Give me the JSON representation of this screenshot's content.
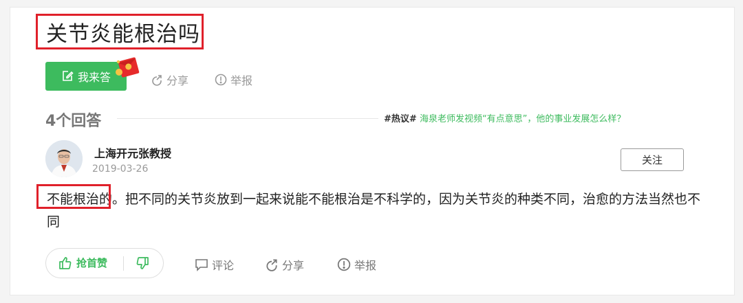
{
  "question": {
    "title": "关节炎能根治吗"
  },
  "toolbar": {
    "answer_label": "我来答",
    "share_label": "分享",
    "report_label": "举报"
  },
  "answers": {
    "count_label": "4个回答",
    "hot_topic_tag": "#热议#",
    "hot_topic_link": "海泉老师发视频“有点意思”，他的事业发展怎么样？"
  },
  "answer": {
    "author": "上海开元张教授",
    "date": "2019-03-26",
    "follow_label": "关注",
    "text": "不能根治的。把不同的关节炎放到一起来说能不能根治是不科学的，因为关节炎的种类不同，治愈的方法当然也不同",
    "actions": {
      "upvote_label": "抢首赞",
      "comment_label": "评论",
      "share_label": "分享",
      "report_label": "举报"
    }
  },
  "colors": {
    "accent": "#3dbb5e",
    "highlight": "#e0202a"
  },
  "icons": {
    "answer": "edit-icon",
    "share": "share-icon",
    "report": "warning-icon",
    "redpacket": "red-envelope-icon",
    "upvote": "thumbs-up-icon",
    "downvote": "thumbs-down-icon",
    "comment": "comment-icon"
  }
}
